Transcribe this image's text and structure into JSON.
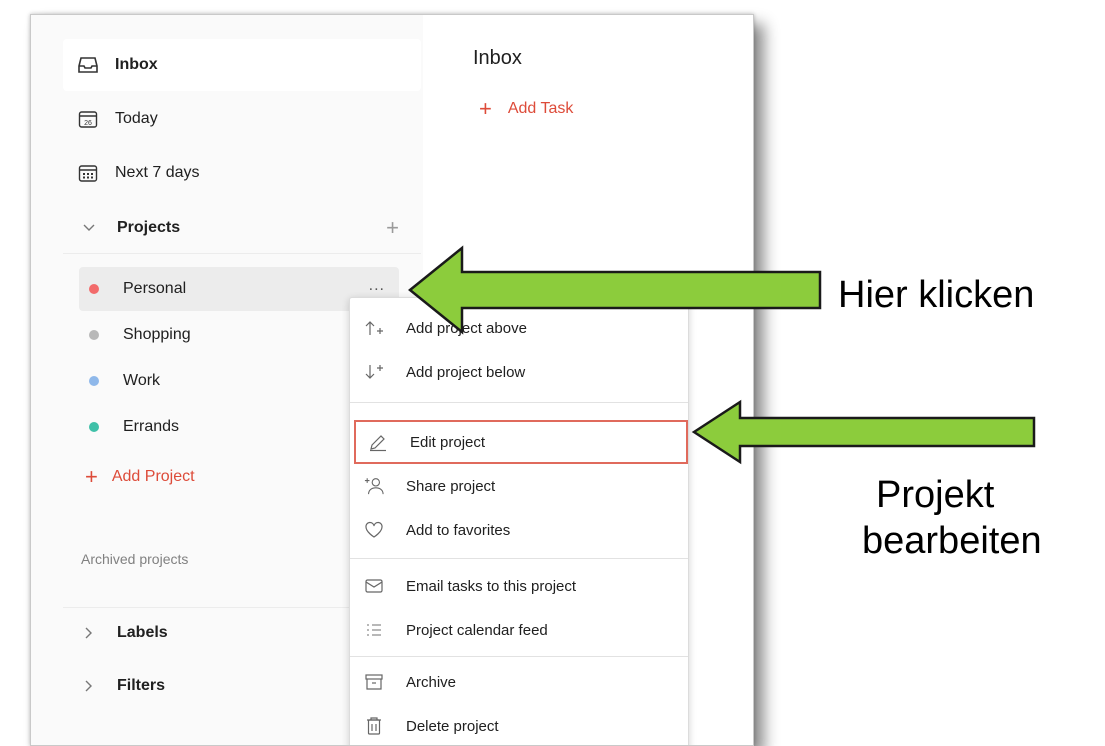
{
  "nav": {
    "inbox": "Inbox",
    "today": "Today",
    "today_day": "26",
    "next7": "Next 7 days"
  },
  "projects_section": {
    "label": "Projects"
  },
  "projects": [
    {
      "label": "Personal",
      "color": "#f26b6b"
    },
    {
      "label": "Shopping",
      "color": "#b8b8b8"
    },
    {
      "label": "Work",
      "color": "#8fb8ea"
    },
    {
      "label": "Errands",
      "color": "#3fc0a8"
    }
  ],
  "project_more": "...",
  "add_project": "Add Project",
  "archived": "Archived projects",
  "labels_section": "Labels",
  "filters_section": "Filters",
  "main": {
    "title": "Inbox",
    "add_task": "Add Task"
  },
  "menu": {
    "add_above": "Add project above",
    "add_below": "Add project below",
    "edit": "Edit project",
    "share": "Share project",
    "favorites": "Add to favorites",
    "email": "Email tasks to this project",
    "calendar": "Project calendar feed",
    "archive": "Archive",
    "delete": "Delete project"
  },
  "annotations": {
    "click_here": "Hier klicken",
    "edit_line1": "Projekt",
    "edit_line2": "bearbeiten"
  },
  "colors": {
    "accent_red": "#dd4b39",
    "arrow_green": "#8ccc3c",
    "highlight_border": "#e06a5c"
  }
}
